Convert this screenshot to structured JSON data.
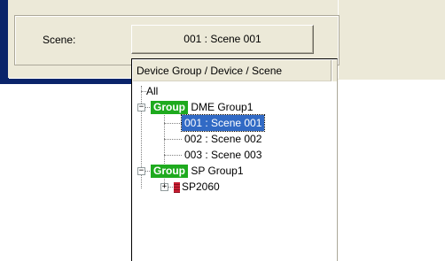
{
  "scene_panel": {
    "label": "Scene:",
    "current_value": "001 : Scene 001"
  },
  "dropdown": {
    "column_header": "Device Group / Device / Scene",
    "tree": {
      "all_label": "All",
      "groups": [
        {
          "badge": "Group",
          "name": "DME Group1",
          "expanded": true,
          "scenes": [
            "001 : Scene 001",
            "002 : Scene 002",
            "003 : Scene 003"
          ],
          "selected_index": 0
        },
        {
          "badge": "Group",
          "name": "SP Group1",
          "expanded": true,
          "devices": [
            {
              "name": "SP2060",
              "expanded": false
            }
          ]
        }
      ]
    }
  },
  "colors": {
    "selection": "#316ac5",
    "group_badge": "#1eaa1e",
    "device_icon": "#c81e32",
    "window_frame": "#0a246a"
  }
}
